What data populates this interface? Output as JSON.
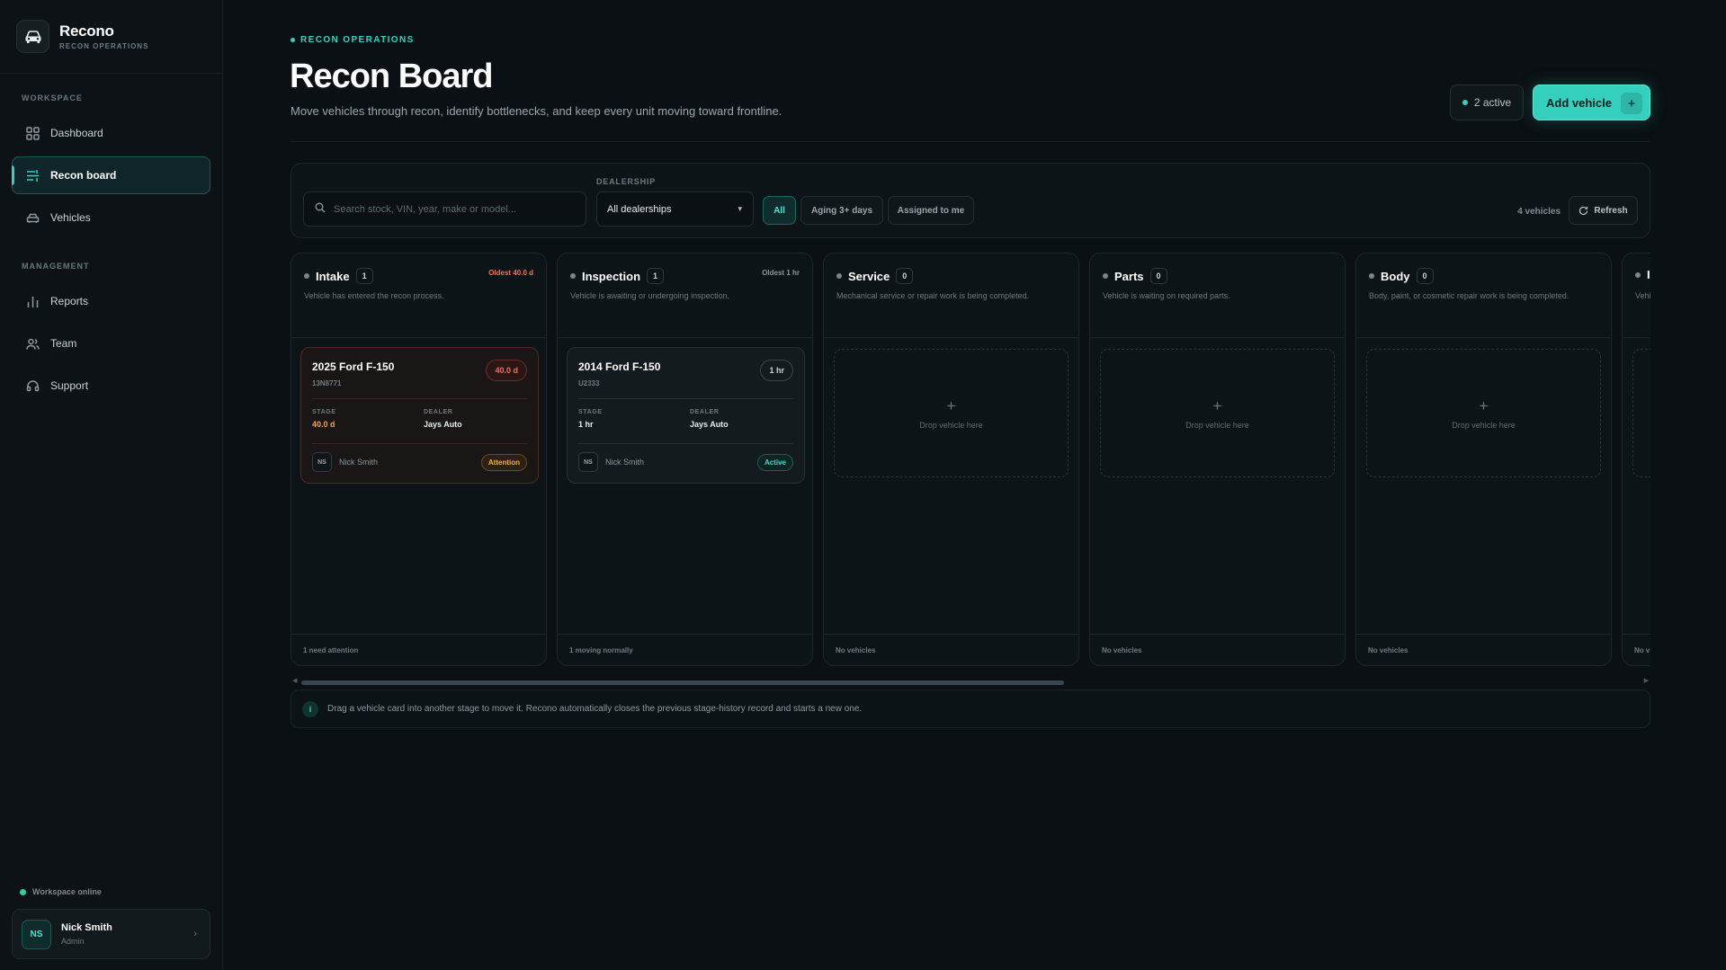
{
  "brand": {
    "name": "Recono",
    "subtitle": "RECON OPERATIONS"
  },
  "sidebar": {
    "workspace_label": "WORKSPACE",
    "management_label": "MANAGEMENT",
    "items": [
      {
        "label": "Dashboard",
        "icon": "grid-icon"
      },
      {
        "label": "Recon board",
        "icon": "board-icon",
        "active": true
      },
      {
        "label": "Vehicles",
        "icon": "car-icon"
      },
      {
        "label": "Reports",
        "icon": "bar-chart-icon"
      },
      {
        "label": "Team",
        "icon": "users-icon"
      },
      {
        "label": "Support",
        "icon": "headset-icon"
      }
    ],
    "status": "Workspace online",
    "user": {
      "initials": "NS",
      "name": "Nick Smith",
      "role": "Admin"
    }
  },
  "header": {
    "eyebrow": "RECON OPERATIONS",
    "title": "Recon Board",
    "description": "Move vehicles through recon, identify bottlenecks, and keep every unit moving toward frontline.",
    "active_count": "2 active",
    "add_button": "Add vehicle",
    "add_icon": "+"
  },
  "toolbar": {
    "search_placeholder": "Search stock, VIN, year, make or model...",
    "dealership_label": "DEALERSHIP",
    "dealership_value": "All dealerships",
    "filters": [
      "All",
      "Aging 3+ days",
      "Assigned to me"
    ],
    "vehicle_count": "4 vehicles",
    "refresh": "Refresh"
  },
  "columns": [
    {
      "name": "Intake",
      "count": "1",
      "oldest": "Oldest 40.0 d",
      "desc": "Vehicle has entered the recon process.",
      "footer": "1 need attention",
      "card": {
        "title": "2025 Ford F-150",
        "stock": "13N8771",
        "age": "40.0 d",
        "stage_label": "STAGE",
        "stage": "40.0 d",
        "dealer_label": "DEALER",
        "dealer": "Jays Auto",
        "initials": "NS",
        "assignee": "Nick Smith",
        "status": "Attention"
      }
    },
    {
      "name": "Inspection",
      "count": "1",
      "oldest": "Oldest 1 hr",
      "desc": "Vehicle is awaiting or undergoing inspection.",
      "footer": "1 moving normally",
      "card": {
        "title": "2014 Ford F-150",
        "stock": "U2333",
        "age": "1 hr",
        "stage_label": "STAGE",
        "stage": "1 hr",
        "dealer_label": "DEALER",
        "dealer": "Jays Auto",
        "initials": "NS",
        "assignee": "Nick Smith",
        "status": "Active"
      }
    },
    {
      "name": "Service",
      "count": "0",
      "desc": "Mechanical service or repair work is being completed.",
      "footer": "No vehicles",
      "drop": "Drop vehicle here"
    },
    {
      "name": "Parts",
      "count": "0",
      "desc": "Vehicle is waiting on required parts.",
      "footer": "No vehicles",
      "drop": "Drop vehicle here"
    },
    {
      "name": "Body",
      "count": "0",
      "desc": "Body, paint, or cosmetic repair work is being completed.",
      "footer": "No vehicles",
      "drop": "Drop vehicle here"
    },
    {
      "name": "I",
      "count": "",
      "desc": "Vehi",
      "footer": "No v",
      "drop": ""
    }
  ],
  "tip": {
    "icon": "i",
    "text": "Drag a vehicle card into another stage to move it. Recono automatically closes the previous stage-history record and starts a new one."
  },
  "colors": {
    "accent": "#34d1c0",
    "warning": "#f0705f",
    "attention": "#f0b04a"
  }
}
